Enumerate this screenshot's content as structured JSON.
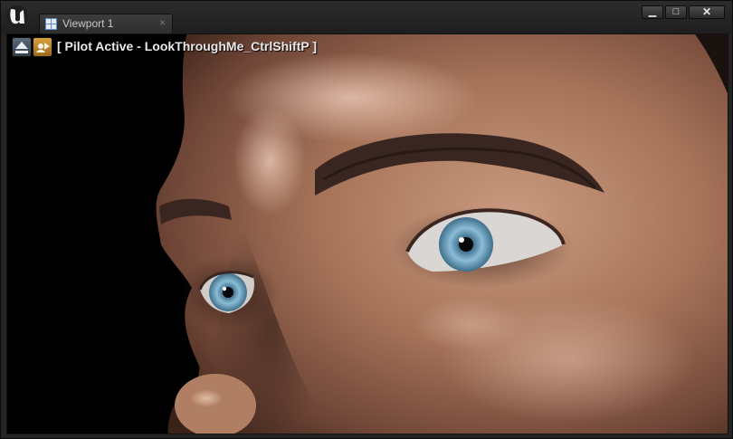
{
  "window": {
    "tab_label": "Viewport 1",
    "tab_close": "×",
    "controls": {
      "minimize": "▁",
      "maximize": "□",
      "close": "✕"
    }
  },
  "viewport": {
    "pilot_label": "[ Pilot Active - LookThroughMe_CtrlShiftP ]"
  },
  "icons": {
    "app_logo": "unreal-engine-logo",
    "tab_icon": "viewport-grid-icon",
    "eject_icon": "eject-icon",
    "pilot_actor_icon": "pilot-actor-icon"
  },
  "colors": {
    "iris": "#7fb3cf",
    "skin": "#b07e62",
    "accent": "#d9a040"
  }
}
